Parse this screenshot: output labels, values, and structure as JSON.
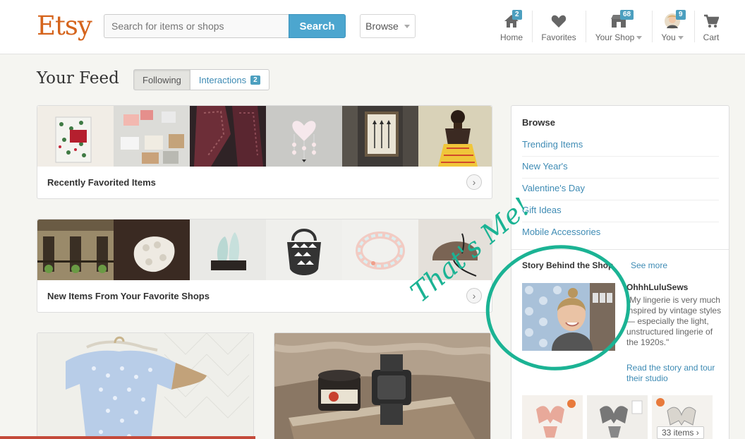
{
  "header": {
    "logo": "Etsy",
    "search_placeholder": "Search for items or shops",
    "search_button": "Search",
    "browse_label": "Browse",
    "nav": [
      {
        "label": "Home",
        "badge": "2",
        "icon": "home-icon"
      },
      {
        "label": "Favorites",
        "badge": "",
        "icon": "heart-icon"
      },
      {
        "label": "Your Shop",
        "badge": "68",
        "icon": "shop-icon"
      },
      {
        "label": "You",
        "badge": "9",
        "icon": "avatar-icon"
      },
      {
        "label": "Cart",
        "badge": "",
        "icon": "cart-icon"
      }
    ]
  },
  "feed": {
    "title": "Your Feed",
    "tabs": [
      {
        "label": "Following"
      },
      {
        "label": "Interactions",
        "badge": "2"
      }
    ],
    "cards": [
      {
        "label": "Recently Favorited Items"
      },
      {
        "label": "New Items From Your Favorite Shops"
      }
    ]
  },
  "sidebar": {
    "browse_title": "Browse",
    "links": [
      "Trending Items",
      "New Year's",
      "Valentine's Day",
      "Gift Ideas",
      "Mobile Accessories"
    ],
    "story": {
      "heading": "Story Behind the Shop",
      "see_more": "See more",
      "shop_name": "OhhhLuluSews",
      "quote": "\"My lingerie is very much inspired by vintage styles — especially the light, unstructured lingerie of the 1920s.\"",
      "read_link": "Read the story and tour their studio",
      "items_count": "33 items"
    }
  },
  "annotation": {
    "text": "That's Me!",
    "color": "#1bb394"
  },
  "colors": {
    "brand": "#d5641c",
    "accent": "#4ca6cf",
    "link": "#3e8bb4"
  }
}
